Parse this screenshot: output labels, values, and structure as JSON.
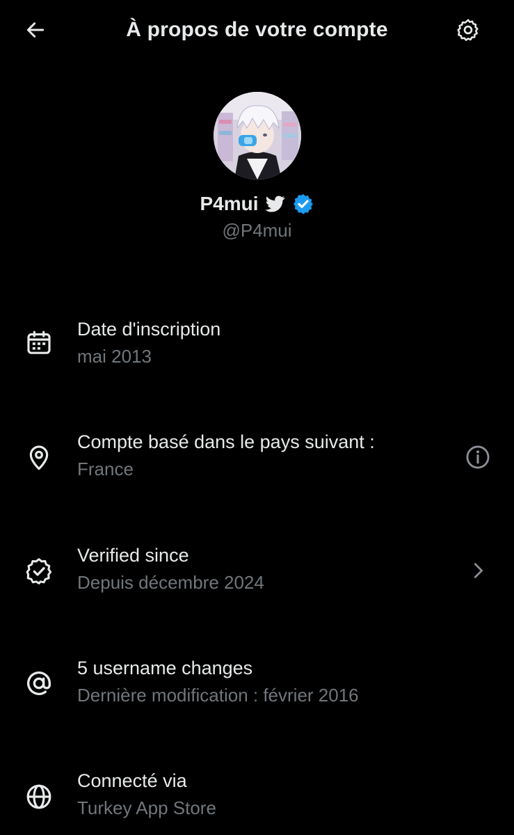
{
  "header": {
    "title": "À propos de votre compte",
    "back_icon": "arrow-left-icon",
    "settings_icon": "gear-icon"
  },
  "profile": {
    "display_name": "P4mui",
    "handle": "@P4mui",
    "bird_icon": "twitter-bird-icon",
    "verified_icon": "verified-badge-icon",
    "verified_color": "#1d9bf0"
  },
  "rows": [
    {
      "icon": "calendar-icon",
      "label": "Date d'inscription",
      "value": "mai 2013"
    },
    {
      "icon": "location-pin-icon",
      "label": "Compte basé dans le pays suivant :",
      "value": "France",
      "trailing_icon": "info-icon"
    },
    {
      "icon": "verified-outline-icon",
      "label": "Verified since",
      "value": "Depuis décembre 2024",
      "trailing_icon": "chevron-right-icon"
    },
    {
      "icon": "at-sign-icon",
      "label": "5 username changes",
      "value": "Dernière modification : février 2016"
    },
    {
      "icon": "globe-icon",
      "label": "Connecté via",
      "value": "Turkey App Store"
    }
  ],
  "colors": {
    "background": "#000000",
    "primary_text": "#e7e9ea",
    "secondary_text": "#71767b",
    "accent": "#1d9bf0"
  }
}
